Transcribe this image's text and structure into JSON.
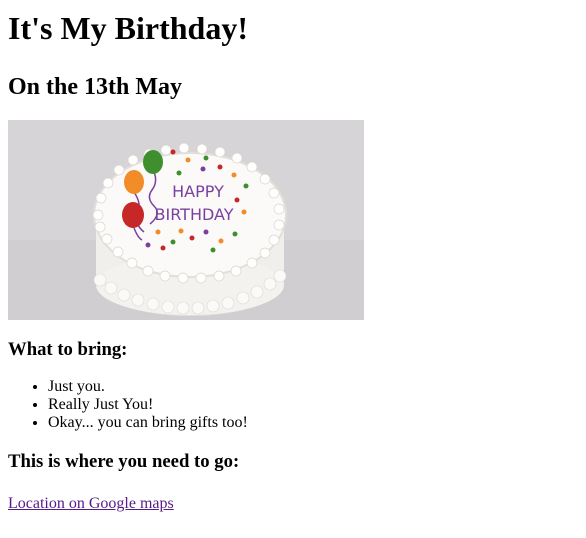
{
  "page": {
    "title": "It's My Birthday!",
    "date": "On the 13th May",
    "cake_image": {
      "message_line1": "HAPPY",
      "message_line2": "BIRTHDAY",
      "colors": {
        "background": "#d6d4d6",
        "frosting": "#f7f6f4",
        "text": "#7a3fa0",
        "balloon_red": "#c62828",
        "balloon_orange": "#f28c28",
        "balloon_green": "#3f8f2f"
      }
    },
    "bring_heading": "What to bring:",
    "bring_items": [
      "Just you.",
      "Really Just You!",
      "Okay... you can bring gifts too!"
    ],
    "where_heading": "This is where you need to go:",
    "map_link": "Location on Google maps"
  }
}
